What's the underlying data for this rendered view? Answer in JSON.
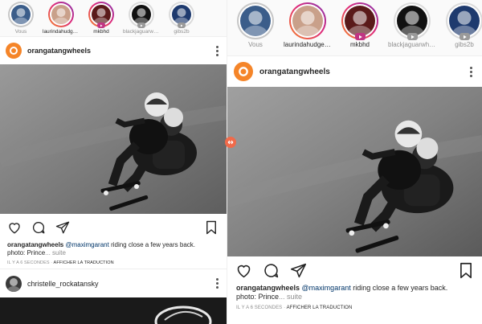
{
  "stories": [
    {
      "name": "Vous",
      "muted": true,
      "badge": ""
    },
    {
      "name": "laurindahudgens_",
      "muted": false,
      "badge": ""
    },
    {
      "name": "mkbhd",
      "muted": false,
      "badge": "igtv"
    },
    {
      "name": "blackjaguarwhite...",
      "muted": true,
      "badge": "video"
    },
    {
      "name": "gibs2b",
      "muted": true,
      "badge": "video"
    }
  ],
  "post": {
    "username": "orangatangwheels",
    "caption_user": "orangatangwheels",
    "mention": "@maximgarant",
    "caption_text": " riding close a few years back.",
    "caption_line2": "photo: Prince",
    "more": "... suite",
    "time": "IL Y A 6 SECONDES",
    "separator": " · ",
    "translate": "AFFICHER LA TRADUCTION"
  },
  "next_post": {
    "username": "christelle_rockatansky"
  },
  "icons": {
    "like": "heart-icon",
    "comment": "comment-icon",
    "share": "send-icon",
    "save": "bookmark-icon",
    "more": "more-dots-icon",
    "handle": "drag-handle-icon"
  },
  "colors": {
    "accent_orange": "#f58529",
    "igtv_pink": "#c13584",
    "mention_blue": "#003569",
    "muted_text": "#8e8e8e"
  }
}
